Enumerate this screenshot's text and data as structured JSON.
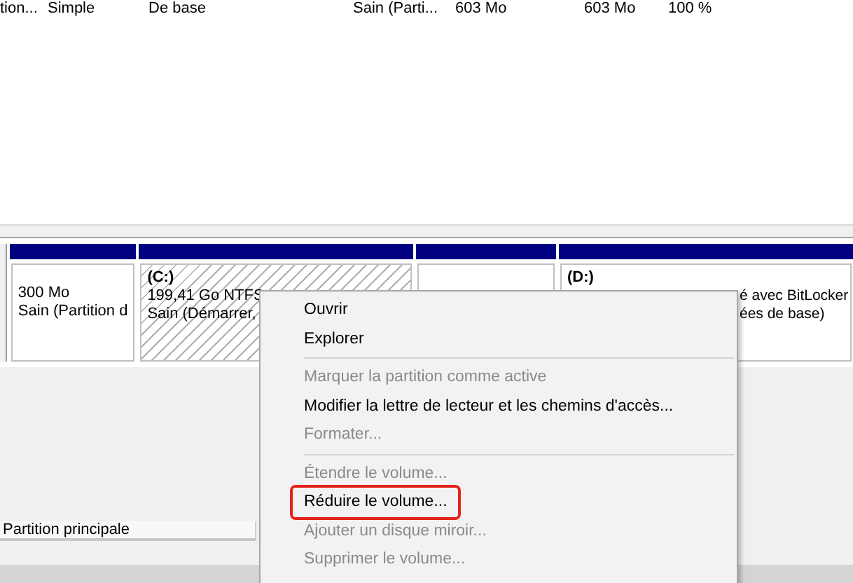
{
  "volume_table": {
    "rows": [
      {
        "cells": [
          "tion...",
          "Simple",
          "De base",
          "Sain (Parti...",
          "603 Mo",
          "603 Mo",
          "100 %"
        ]
      }
    ]
  },
  "disk": {
    "partitions": [
      {
        "kind": "plain",
        "selected": false,
        "lines": [
          "300 Mo",
          "Sain (Partition d"
        ]
      },
      {
        "kind": "plain",
        "selected": true,
        "title": "(C:)",
        "lines": [
          "199,41 Go NTFS",
          "Sain (Démarrer,"
        ]
      },
      {
        "kind": "plain",
        "selected": false
      },
      {
        "kind": "covered",
        "selected": false,
        "title": "(D:)",
        "lines": [
          "é avec BitLocker",
          "ées de base)"
        ]
      }
    ]
  },
  "legend": [
    {
      "label": "Partition principale"
    }
  ],
  "context_menu": {
    "items": [
      {
        "kind": "item",
        "label": "Ouvrir",
        "disabled": false,
        "annotated": false
      },
      {
        "kind": "item",
        "label": "Explorer",
        "disabled": false,
        "annotated": false
      },
      {
        "kind": "separator"
      },
      {
        "kind": "item",
        "label": "Marquer la partition comme active",
        "disabled": true,
        "annotated": false
      },
      {
        "kind": "item",
        "label": "Modifier la lettre de lecteur et les chemins d'accès...",
        "disabled": false,
        "annotated": false
      },
      {
        "kind": "item",
        "label": "Formater...",
        "disabled": true,
        "annotated": false
      },
      {
        "kind": "separator"
      },
      {
        "kind": "item",
        "label": "Étendre le volume...",
        "disabled": true,
        "annotated": false
      },
      {
        "kind": "item",
        "label": "Réduire le volume...",
        "disabled": false,
        "annotated": true
      },
      {
        "kind": "item",
        "label": "Ajouter un disque miroir...",
        "disabled": true,
        "annotated": false
      },
      {
        "kind": "item",
        "label": "Supprimer le volume...",
        "disabled": true,
        "annotated": false
      }
    ]
  }
}
